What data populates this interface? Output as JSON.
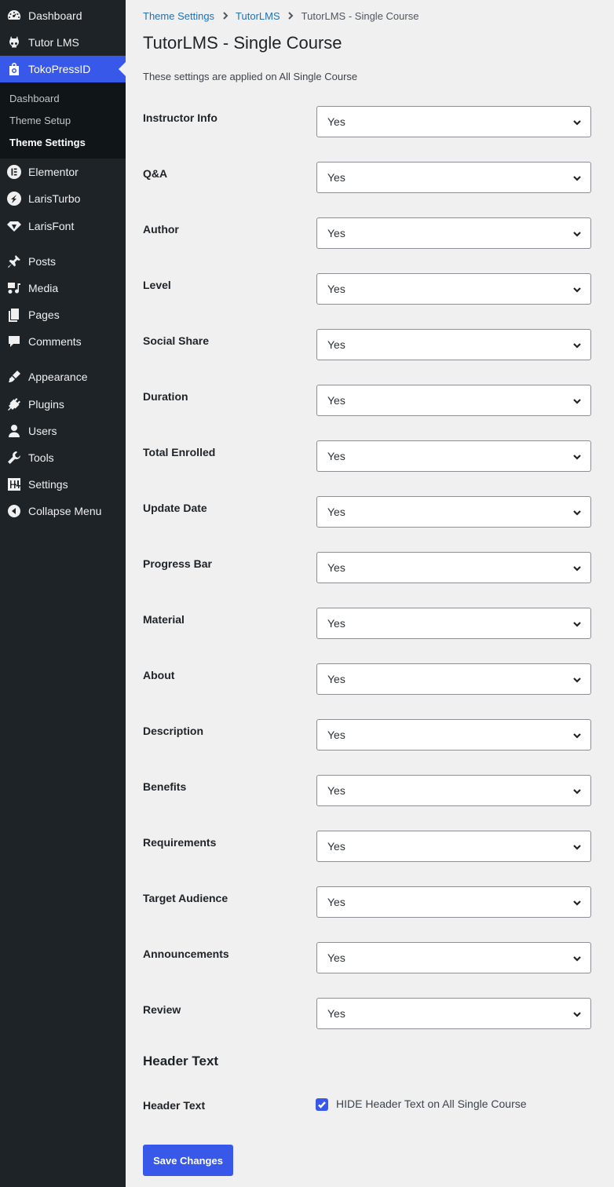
{
  "sidebar": {
    "items": [
      {
        "name": "dashboard",
        "label": "Dashboard",
        "icon": "dashboard-icon"
      },
      {
        "name": "tutor-lms",
        "label": "Tutor LMS",
        "icon": "tutor-icon"
      },
      {
        "name": "tokopressid",
        "label": "TokoPressID",
        "icon": "shopping-bag-icon",
        "active": true
      },
      {
        "name": "elementor",
        "label": "Elementor",
        "icon": "elementor-icon"
      },
      {
        "name": "laristurbo",
        "label": "LarisTurbo",
        "icon": "turbo-icon"
      },
      {
        "name": "larisfont",
        "label": "LarisFont",
        "icon": "diamond-icon"
      },
      {
        "name": "posts",
        "label": "Posts",
        "icon": "pin-icon"
      },
      {
        "name": "media",
        "label": "Media",
        "icon": "media-icon"
      },
      {
        "name": "pages",
        "label": "Pages",
        "icon": "pages-icon"
      },
      {
        "name": "comments",
        "label": "Comments",
        "icon": "comment-icon"
      },
      {
        "name": "appearance",
        "label": "Appearance",
        "icon": "brush-icon"
      },
      {
        "name": "plugins",
        "label": "Plugins",
        "icon": "plug-icon"
      },
      {
        "name": "users",
        "label": "Users",
        "icon": "user-icon"
      },
      {
        "name": "tools",
        "label": "Tools",
        "icon": "wrench-icon"
      },
      {
        "name": "settings",
        "label": "Settings",
        "icon": "settings-icon"
      },
      {
        "name": "collapse-menu",
        "label": "Collapse Menu",
        "icon": "collapse-icon"
      }
    ],
    "submenu": [
      {
        "label": "Dashboard"
      },
      {
        "label": "Theme Setup"
      },
      {
        "label": "Theme Settings",
        "current": true
      }
    ]
  },
  "breadcrumb": {
    "items": [
      "Theme Settings",
      "TutorLMS"
    ],
    "current": "TutorLMS - Single Course"
  },
  "page": {
    "title": "TutorLMS - Single Course",
    "description": "These settings are applied on All Single Course"
  },
  "settings": [
    {
      "label": "Instructor Info",
      "value": "Yes"
    },
    {
      "label": "Q&A",
      "value": "Yes"
    },
    {
      "label": "Author",
      "value": "Yes"
    },
    {
      "label": "Level",
      "value": "Yes"
    },
    {
      "label": "Social Share",
      "value": "Yes"
    },
    {
      "label": "Duration",
      "value": "Yes"
    },
    {
      "label": "Total Enrolled",
      "value": "Yes"
    },
    {
      "label": "Update Date",
      "value": "Yes"
    },
    {
      "label": "Progress Bar",
      "value": "Yes"
    },
    {
      "label": "Material",
      "value": "Yes"
    },
    {
      "label": "About",
      "value": "Yes"
    },
    {
      "label": "Description",
      "value": "Yes"
    },
    {
      "label": "Benefits",
      "value": "Yes"
    },
    {
      "label": "Requirements",
      "value": "Yes"
    },
    {
      "label": "Target Audience",
      "value": "Yes"
    },
    {
      "label": "Announcements",
      "value": "Yes"
    },
    {
      "label": "Review",
      "value": "Yes"
    }
  ],
  "header_section": {
    "heading": "Header Text",
    "label": "Header Text",
    "checkbox_label": "HIDE Header Text on All Single Course",
    "checked": true
  },
  "save_button": "Save Changes",
  "colors": {
    "sidebar_bg": "#1d2327",
    "accent": "#3858e9",
    "link": "#2271b1",
    "content_bg": "#f0f0f1"
  }
}
